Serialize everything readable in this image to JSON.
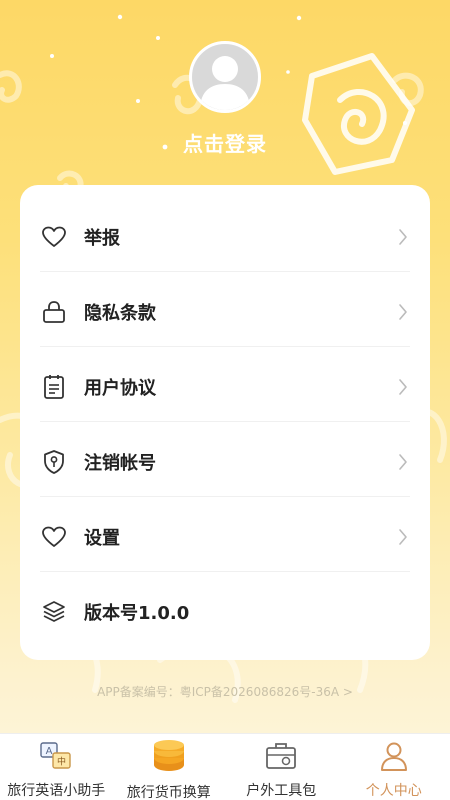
{
  "profile": {
    "login_label": "点击登录"
  },
  "menu": [
    {
      "label": "举报",
      "icon": "heart-icon",
      "has_chevron": true
    },
    {
      "label": "隐私条款",
      "icon": "lock-icon",
      "has_chevron": true
    },
    {
      "label": "用户协议",
      "icon": "document-icon",
      "has_chevron": true
    },
    {
      "label": "注销帐号",
      "icon": "shield-key-icon",
      "has_chevron": true
    },
    {
      "label": "设置",
      "icon": "heart-icon",
      "has_chevron": true
    },
    {
      "label": "版本号1.0.0",
      "icon": "layers-icon",
      "has_chevron": false
    }
  ],
  "icp_text": "APP备案编号：粤ICP备2026086826号-36A >",
  "tabbar": [
    {
      "label": "旅行英语小助手",
      "icon": "translate-icon",
      "active": false
    },
    {
      "label": "旅行货币换算",
      "icon": "coins-icon",
      "active": false
    },
    {
      "label": "户外工具包",
      "icon": "toolbox-icon",
      "active": false
    },
    {
      "label": "个人中心",
      "icon": "person-icon",
      "active": true
    }
  ],
  "colors": {
    "accent": "#d2935a",
    "background_top": "#fdd866",
    "coins": "#f5a623"
  }
}
